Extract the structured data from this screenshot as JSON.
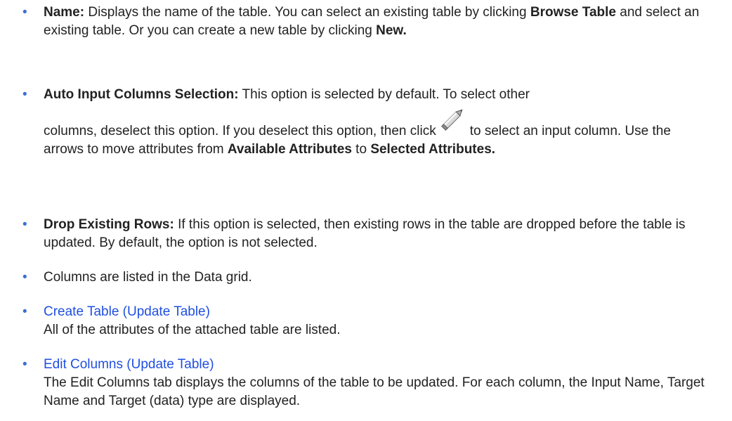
{
  "items": [
    {
      "term": "Name:",
      "t1": " Displays the name of the table. You can select an existing table by clicking ",
      "b1": "Browse Table",
      "t2": " and select an existing table. Or you can create a new table by clicking ",
      "b2": "New."
    },
    {
      "term": "Auto Input Columns Selection:",
      "t1": " This option is selected by default. To select other",
      "t2": "columns, deselect this option. If you deselect this option, then click",
      "t3": "to select an input column. Use the arrows to move attributes from ",
      "b1": "Available Attributes",
      "t4": " to ",
      "b2": "Selected Attributes.",
      "icon": "pencil-icon"
    },
    {
      "term": "Drop Existing Rows:",
      "t1": " If this option is selected, then existing rows in the table are dropped before the table is updated. By default, the option is not selected."
    },
    {
      "t1": "Columns are listed in the Data grid."
    },
    {
      "link": "Create Table (Update Table)",
      "desc": "All of the attributes of the attached table are listed."
    },
    {
      "link": "Edit Columns (Update Table)",
      "desc": "The Edit Columns tab displays the columns of the table to be updated. For each column, the Input Name, Target Name and Target (data) type are displayed."
    }
  ],
  "colors": {
    "bullet": "#3b6fd8",
    "link": "#1f4fe0",
    "text": "#222222"
  }
}
